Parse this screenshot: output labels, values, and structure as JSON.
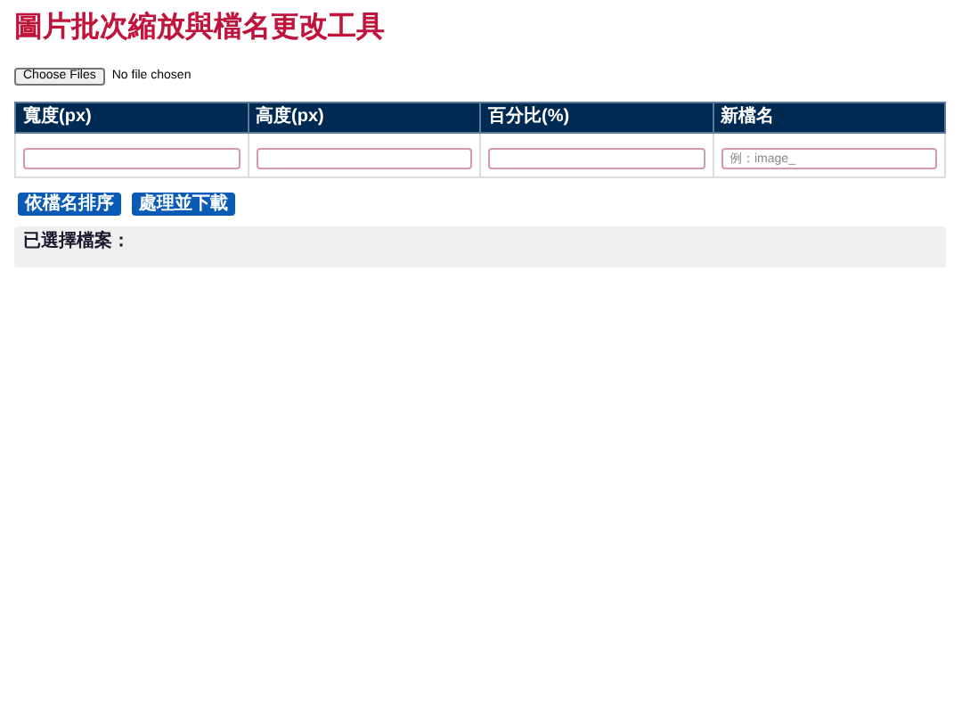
{
  "title": "圖片批次縮放與檔名更改工具",
  "file_picker": {
    "button": "Choose Files",
    "status": "No file chosen"
  },
  "table": {
    "columns": [
      {
        "label": "寬度(px)"
      },
      {
        "label": "高度(px)"
      },
      {
        "label": "百分比(%)"
      },
      {
        "label": "新檔名",
        "placeholder": "例：image_"
      }
    ]
  },
  "buttons": [
    "依檔名排序",
    "處理並下載"
  ],
  "selected_files": {
    "label": "已選擇檔案："
  }
}
